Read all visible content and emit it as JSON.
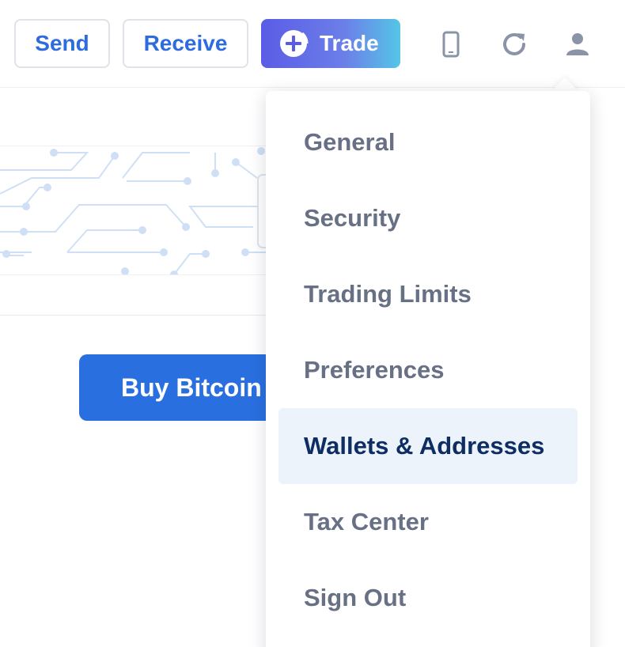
{
  "toolbar": {
    "send_label": "Send",
    "receive_label": "Receive",
    "trade_label": "Trade",
    "icons": [
      "plus-circle-icon",
      "mobile-icon",
      "refresh-icon",
      "user-icon"
    ]
  },
  "main": {
    "buy_button_label": "Buy Bitcoin"
  },
  "menu": {
    "items": [
      {
        "label": "General"
      },
      {
        "label": "Security"
      },
      {
        "label": "Trading Limits"
      },
      {
        "label": "Preferences"
      },
      {
        "label": "Wallets & Addresses"
      },
      {
        "label": "Tax Center"
      },
      {
        "label": "Sign Out"
      }
    ],
    "active_label": "Wallets & Addresses"
  },
  "colors": {
    "primary_blue": "#2a6fe0",
    "trade_gradient_start": "#5b5ce6",
    "trade_gradient_end": "#55c6e6",
    "menu_text": "#677084",
    "menu_active_text": "#0e2d63",
    "menu_active_bg": "#edf3fb"
  }
}
